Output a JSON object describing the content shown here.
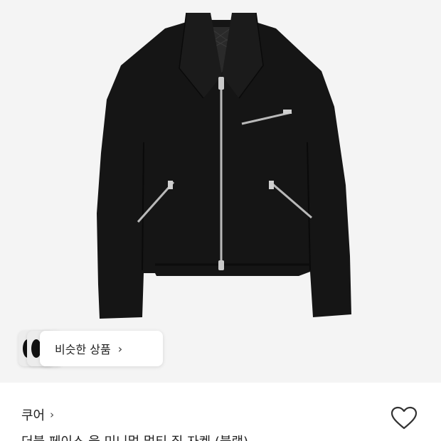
{
  "product": {
    "image_alt": "black wool zip jacket",
    "similar_label": "비슷한 상품",
    "similar_chevron": "›",
    "brand": "쿠어",
    "brand_chevron": "›",
    "title": "더블 페이스 울 미니멀 멀티 집 자켓 (블랙)",
    "wishlist_icon": "heart-outline-icon"
  },
  "colors": {
    "background": "#f4f4f4",
    "jacket": "#151515",
    "zipper": "#b9b9b9"
  }
}
